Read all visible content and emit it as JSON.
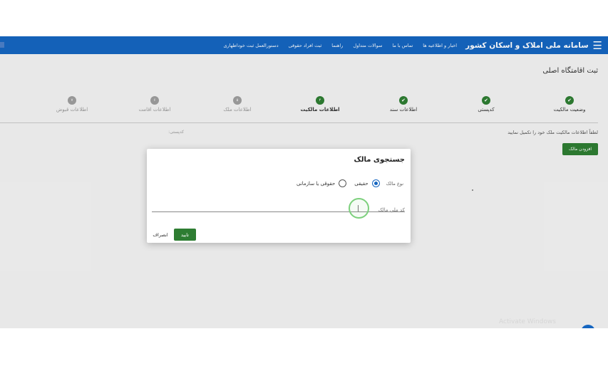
{
  "header": {
    "brand": "سامانه ملی املاک و اسکان کشور",
    "menu_icon": "hamburger-icon",
    "nav": [
      "اخبار و اطلاعیه ها",
      "تماس با ما",
      "سوالات متداول",
      "راهنما",
      "ثبت افراد حقوقی",
      "دستورالعمل ثبت خوداظهاری"
    ]
  },
  "page": {
    "title": "ثبت اقامتگاه اصلی",
    "info_text": "لطفاً اطلاعات مالکیت ملک خود را تکمیل نمایید",
    "faded_text": "کدپستی:",
    "add_owner_label": "افزودن مالک"
  },
  "steps": [
    {
      "label": "وضعیت مالکیت",
      "state": "done",
      "icon": "✔"
    },
    {
      "label": "کدپستی",
      "state": "done",
      "icon": "✔"
    },
    {
      "label": "اطلاعات سند",
      "state": "done",
      "icon": "✔"
    },
    {
      "label": "اطلاعات مالکیت",
      "state": "active",
      "icon": "۴"
    },
    {
      "label": "اطلاعات ملک",
      "state": "todo",
      "icon": "۵"
    },
    {
      "label": "اطلاعات اقامت",
      "state": "todo",
      "icon": "۶"
    },
    {
      "label": "اطلاعات قبوض",
      "state": "todo",
      "icon": "۷"
    }
  ],
  "modal": {
    "title": "جستجوی مالک",
    "owner_type_label": "نوع مالک",
    "options": [
      {
        "label": "حقیقی",
        "checked": true
      },
      {
        "label": "حقوقی یا سازمانی",
        "checked": false
      }
    ],
    "national_code_placeholder": "کد ملی مالک",
    "national_code_value": "",
    "confirm_label": "تایید",
    "cancel_label": "انصراف"
  },
  "watermark": "Activate Windows",
  "colors": {
    "brand_blue": "#1565c0",
    "success_green": "#2e7d32"
  }
}
